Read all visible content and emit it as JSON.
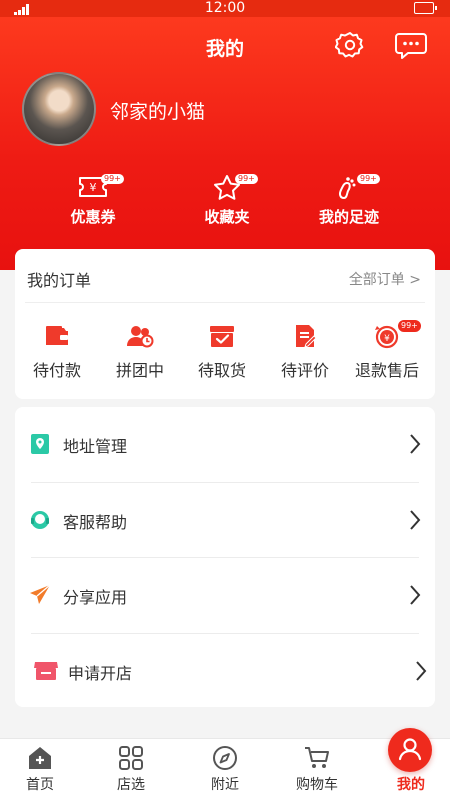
{
  "status_bar": {
    "time": "12:00"
  },
  "header": {
    "title": "我的",
    "icons": [
      "settings-icon",
      "message-icon"
    ]
  },
  "profile": {
    "username": "邻家的小猫"
  },
  "quick_links": [
    {
      "label": "优惠券",
      "icon": "coupon-icon",
      "badge": "99+"
    },
    {
      "label": "收藏夹",
      "icon": "star-icon",
      "badge": "99+"
    },
    {
      "label": "我的足迹",
      "icon": "footprint-icon",
      "badge": "99+"
    }
  ],
  "orders": {
    "title": "我的订单",
    "view_all": "全部订单 >",
    "statuses": [
      {
        "label": "待付款",
        "icon": "wallet-icon"
      },
      {
        "label": "拼团中",
        "icon": "group-buy-icon"
      },
      {
        "label": "待取货",
        "icon": "pickup-box-icon"
      },
      {
        "label": "待评价",
        "icon": "review-icon"
      },
      {
        "label": "退款售后",
        "icon": "refund-icon",
        "badge": "99+"
      }
    ]
  },
  "menu": [
    {
      "label": "地址管理",
      "icon": "address-icon"
    },
    {
      "label": "客服帮助",
      "icon": "customer-service-icon"
    },
    {
      "label": "分享应用",
      "icon": "share-icon"
    },
    {
      "label": "申请开店",
      "icon": "store-icon"
    }
  ],
  "tabbar": [
    {
      "label": "首页",
      "icon": "home-icon"
    },
    {
      "label": "店选",
      "icon": "grid-icon"
    },
    {
      "label": "附近",
      "icon": "compass-icon"
    },
    {
      "label": "购物车",
      "icon": "cart-icon"
    },
    {
      "label": "我的",
      "icon": "profile-icon",
      "active": true
    }
  ],
  "colors": {
    "primary": "#EE2A1D",
    "teal": "#2BC9A6",
    "orange": "#F27B2A"
  }
}
